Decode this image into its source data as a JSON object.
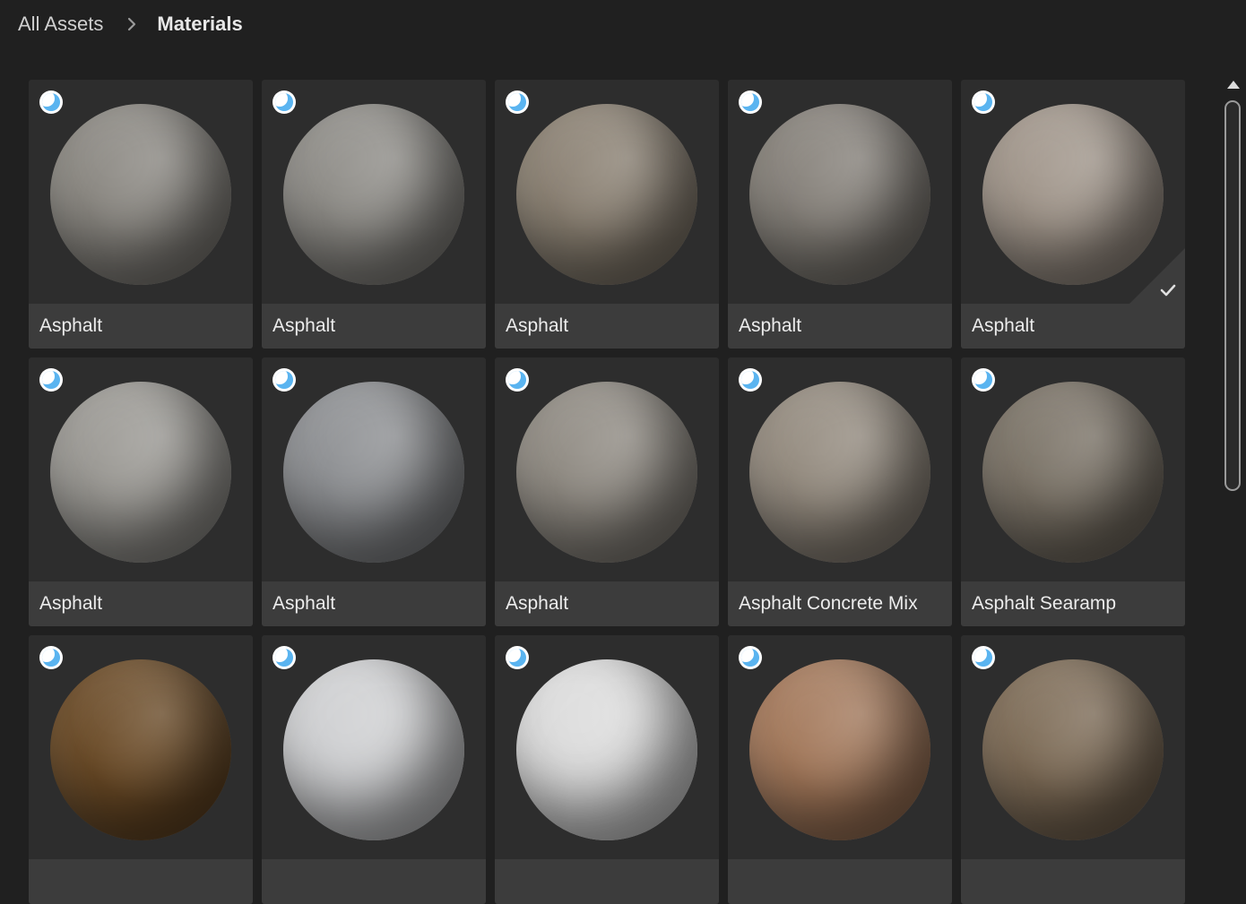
{
  "breadcrumb": {
    "root": "All Assets",
    "current": "Materials"
  },
  "assets": [
    {
      "label": "Asphalt",
      "color": "#8a8781",
      "selected": false
    },
    {
      "label": "Asphalt",
      "color": "#8e8c87",
      "selected": false
    },
    {
      "label": "Asphalt",
      "color": "#8a8072",
      "selected": false
    },
    {
      "label": "Asphalt",
      "color": "#858079",
      "selected": false
    },
    {
      "label": "Asphalt",
      "color": "#a0958a",
      "selected": true
    },
    {
      "label": "Asphalt",
      "color": "#9a9893",
      "selected": false
    },
    {
      "label": "Asphalt",
      "color": "#8d8f92",
      "selected": false
    },
    {
      "label": "Asphalt",
      "color": "#8f8a82",
      "selected": false
    },
    {
      "label": "Asphalt Concrete Mix",
      "color": "#938a7e",
      "selected": false
    },
    {
      "label": "Asphalt Searamp",
      "color": "#7a7266",
      "selected": false
    },
    {
      "label": "",
      "color": "#6a4a26",
      "selected": false
    },
    {
      "label": "",
      "color": "#cfd0d2",
      "selected": false
    },
    {
      "label": "",
      "color": "#dcdcdc",
      "selected": false
    },
    {
      "label": "",
      "color": "#a3785a",
      "selected": false
    },
    {
      "label": "",
      "color": "#7d6b56",
      "selected": false
    }
  ],
  "icons": {
    "badge": "material-type-icon",
    "check": "checkmark-icon",
    "chevron": "chevron-right-icon",
    "scroll_up": "scroll-up-arrow-icon"
  },
  "colors": {
    "background": "#202020",
    "card": "#2d2d2d",
    "label_bar": "#3c3c3c",
    "badge_accent": "#5ab4f0"
  }
}
